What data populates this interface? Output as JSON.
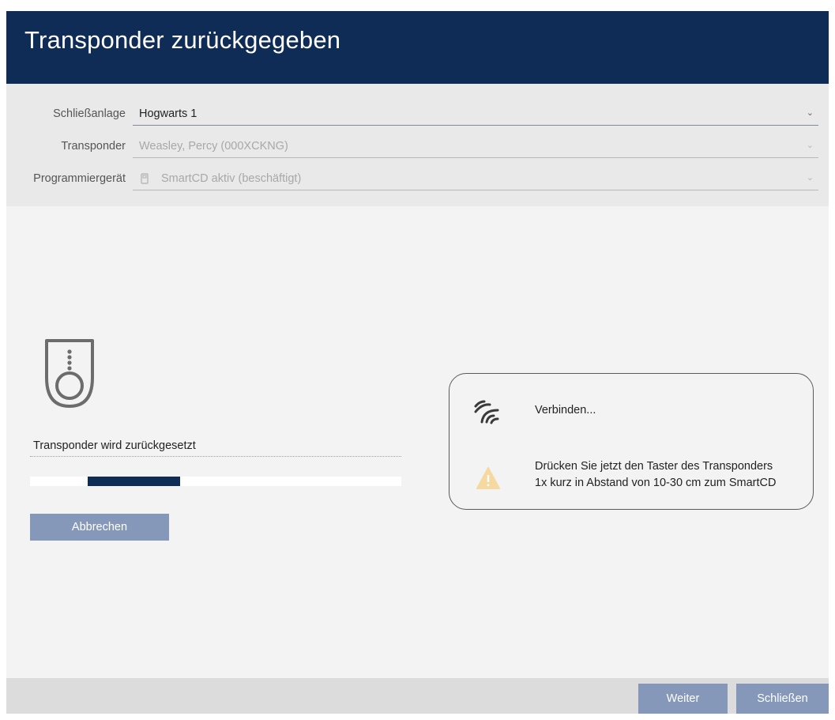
{
  "window": {
    "title": "Transponder zurückgegeben"
  },
  "form": {
    "system": {
      "label": "Schließanlage",
      "value": "Hogwarts 1"
    },
    "transponder": {
      "label": "Transponder",
      "value": "Weasley, Percy (000XCKNG)"
    },
    "device": {
      "label": "Programmiergerät",
      "value": "SmartCD aktiv (beschäftigt)"
    }
  },
  "status": {
    "text": "Transponder wird zurückgesetzt",
    "progress_start": 0.155,
    "progress_fill": 0.25
  },
  "buttons": {
    "cancel": "Abbrechen",
    "next": "Weiter",
    "close": "Schließen"
  },
  "info": {
    "connecting": "Verbinden...",
    "hint_line1": "Drücken Sie jetzt den Taster des Transponders",
    "hint_line2": "1x kurz in Abstand von 10-30 cm zum SmartCD"
  },
  "colors": {
    "titlebar": "#0e2c55",
    "button": "#8698ba",
    "warning": "#f5d9a0"
  },
  "icons": {
    "device": "smartcd-device-icon",
    "transponder": "transponder-key-icon",
    "wireless": "wireless-signal-icon",
    "warning": "warning-triangle-icon",
    "dropdown": "chevron-down-icon"
  }
}
